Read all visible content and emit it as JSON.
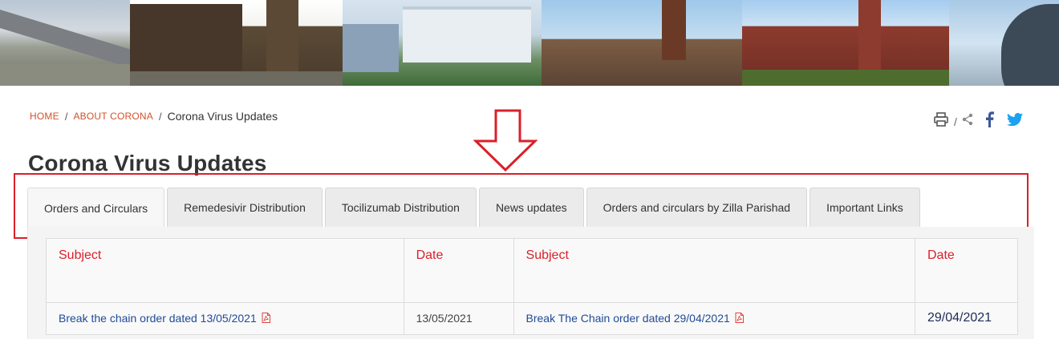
{
  "breadcrumb": {
    "home": "HOME",
    "about": "ABOUT CORONA",
    "separator": "/",
    "current": "Corona Virus Updates"
  },
  "utilities": {
    "print_icon": "print-icon",
    "separator": "/",
    "share_icon": "share-icon",
    "facebook_icon": "facebook-icon",
    "twitter_icon": "twitter-icon"
  },
  "page_title": "Corona Virus Updates",
  "tabs": [
    {
      "label": "Orders and Circulars",
      "active": true
    },
    {
      "label": "Remedesivir Distribution",
      "active": false
    },
    {
      "label": "Tocilizumab Distribution",
      "active": false
    },
    {
      "label": "News updates",
      "active": false
    },
    {
      "label": "Orders and circulars by Zilla Parishad",
      "active": false
    },
    {
      "label": "Important Links",
      "active": false
    }
  ],
  "table": {
    "headers": [
      "Subject",
      "Date",
      "Subject",
      "Date"
    ],
    "rows": [
      {
        "subject_1": "Break the chain order dated 13/05/2021",
        "date_1": "13/05/2021",
        "subject_2": "Break The Chain order dated 29/04/2021",
        "date_2": "29/04/2021"
      }
    ]
  },
  "colors": {
    "breadcrumb_link": "#d3522a",
    "table_header": "#d8222a",
    "table_link": "#1f4b98",
    "annotation": "#d9202a",
    "facebook": "#3b5998",
    "twitter": "#1da1f2"
  }
}
